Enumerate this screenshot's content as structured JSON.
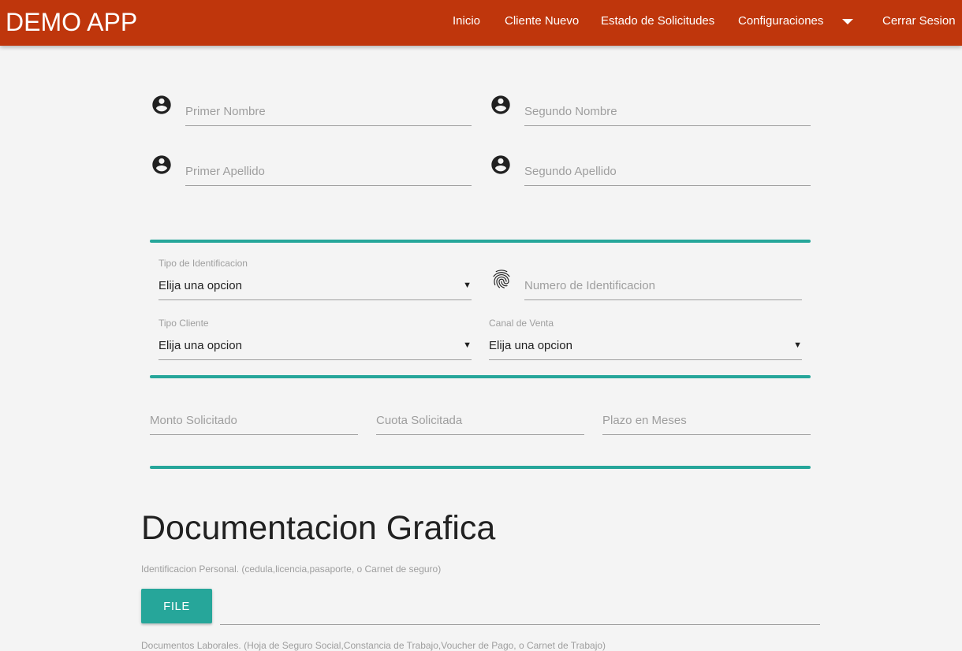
{
  "navbar": {
    "brand": "DEMO APP",
    "items": [
      {
        "label": "Inicio"
      },
      {
        "label": "Cliente Nuevo"
      },
      {
        "label": "Estado de Solicitudes"
      },
      {
        "label": "Configuraciones"
      },
      {
        "label": "Cerrar Sesion"
      }
    ],
    "dropdown_icon": "arrow-drop-down-icon",
    "background_color": "#bf360c"
  },
  "names": {
    "icon": "account-circle-icon",
    "primer_nombre": {
      "placeholder": "Primer Nombre",
      "value": ""
    },
    "segundo_nombre": {
      "placeholder": "Segundo Nombre",
      "value": ""
    },
    "primer_apellido": {
      "placeholder": "Primer Apellido",
      "value": ""
    },
    "segundo_apellido": {
      "placeholder": "Segundo Apellido",
      "value": ""
    }
  },
  "identification": {
    "tipo_identificacion": {
      "label": "Tipo de Identificacion",
      "selected": "Elija una opcion"
    },
    "numero_identificacion": {
      "placeholder": "Numero de Identificacion",
      "value": "",
      "icon": "fingerprint-icon"
    },
    "tipo_cliente": {
      "label": "Tipo Cliente",
      "selected": "Elija una opcion"
    },
    "canal_venta": {
      "label": "Canal de Venta",
      "selected": "Elija una opcion"
    },
    "select_arrow": "▼"
  },
  "loan": {
    "monto": {
      "placeholder": "Monto Solicitado",
      "value": ""
    },
    "cuota": {
      "placeholder": "Cuota Solicitada",
      "value": ""
    },
    "plazo": {
      "placeholder": "Plazo en Meses",
      "value": ""
    }
  },
  "documents": {
    "heading": "Documentacion Grafica",
    "personal_id_help": "Identificacion Personal. (cedula,licencia,pasaporte, o Carnet de seguro)",
    "file_button": "FILE",
    "labor_docs_help": "Documentos Laborales. (Hoja de Seguro Social,Constancia de Trabajo,Voucher de Pago, o Carnet de Trabajo)"
  },
  "accent_color": "#26a69a"
}
